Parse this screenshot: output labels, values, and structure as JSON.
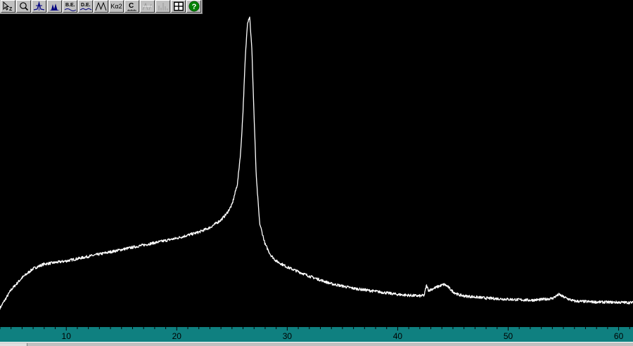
{
  "toolbar": {
    "buttons": [
      {
        "name": "pointer-zoom-button",
        "icon": "pointer-z-icon",
        "text": "Z"
      },
      {
        "name": "zoom-button",
        "icon": "magnifier-icon",
        "text": ""
      },
      {
        "name": "peak-search-button",
        "icon": "peak-icon",
        "text": ""
      },
      {
        "name": "fill-peaks-button",
        "icon": "filled-peaks-icon",
        "text": ""
      },
      {
        "name": "background-edit-button",
        "icon": "be-icon",
        "text": "B.E."
      },
      {
        "name": "data-edit-button",
        "icon": "de-icon",
        "text": "D.E."
      },
      {
        "name": "profile-button",
        "icon": "profile-icon",
        "text": ""
      },
      {
        "name": "ka2-button",
        "icon": "ka2-icon",
        "text": "Kα2"
      },
      {
        "name": "calibrate-button",
        "icon": "c-icon",
        "text": "C"
      },
      {
        "name": "marker-button",
        "icon": "marker-disabled-icon",
        "text": ""
      },
      {
        "name": "stick-button",
        "icon": "sticks-disabled-icon",
        "text": ""
      },
      {
        "name": "grid-button",
        "icon": "grid-icon",
        "text": ""
      },
      {
        "name": "help-button",
        "icon": "help-icon",
        "text": "?"
      }
    ]
  },
  "colors": {
    "plot_background": "#000000",
    "trace": "#ffffff",
    "axis_bar": "#0f8080",
    "axis_text": "#000000",
    "help_green": "#008000"
  },
  "chart_data": {
    "type": "line",
    "xlabel": "",
    "ylabel": "",
    "xlim": [
      4,
      61.3
    ],
    "ylim": [
      0,
      100
    ],
    "x_ticks": [
      10,
      20,
      30,
      40,
      50,
      60
    ],
    "x_tick_labels": [
      "10",
      "20",
      "30",
      "40",
      "50",
      "60"
    ],
    "grid": false,
    "series": [
      {
        "x": [
          4.0,
          5.0,
          6.0,
          7.0,
          8.0,
          9.0,
          10.0,
          12.0,
          14.0,
          16.0,
          18.0,
          20.0,
          21.0,
          22.0,
          23.0,
          24.0,
          24.5,
          25.0,
          25.5,
          25.8,
          26.0,
          26.2,
          26.4,
          26.6,
          26.8,
          27.0,
          27.2,
          27.5,
          28.0,
          28.5,
          29.0,
          30.0,
          32.0,
          34.0,
          36.0,
          38.0,
          40.0,
          41.0,
          42.0,
          42.4,
          42.6,
          42.8,
          43.2,
          43.8,
          44.2,
          44.5,
          45.0,
          45.5,
          46.0,
          48.0,
          50.0,
          52.0,
          53.0,
          54.0,
          54.6,
          55.0,
          55.5,
          56.0,
          58.0,
          60.0,
          61.3
        ],
        "y": [
          3,
          9,
          13,
          16,
          17.5,
          18,
          18.5,
          20,
          21.5,
          23,
          24.5,
          26,
          27,
          28,
          29.5,
          32,
          34,
          37,
          44,
          55,
          68,
          85,
          97,
          99,
          88,
          66,
          46,
          31,
          24,
          20.5,
          18.5,
          16.5,
          13.5,
          11,
          9.5,
          8.5,
          7.5,
          7.2,
          7.0,
          7.2,
          10.5,
          8.8,
          9.4,
          10.3,
          10.8,
          10.2,
          8.4,
          7.4,
          7.0,
          6.3,
          5.9,
          5.6,
          5.8,
          6.2,
          7.5,
          6.7,
          5.9,
          5.3,
          5.0,
          4.9,
          4.8
        ]
      }
    ]
  }
}
